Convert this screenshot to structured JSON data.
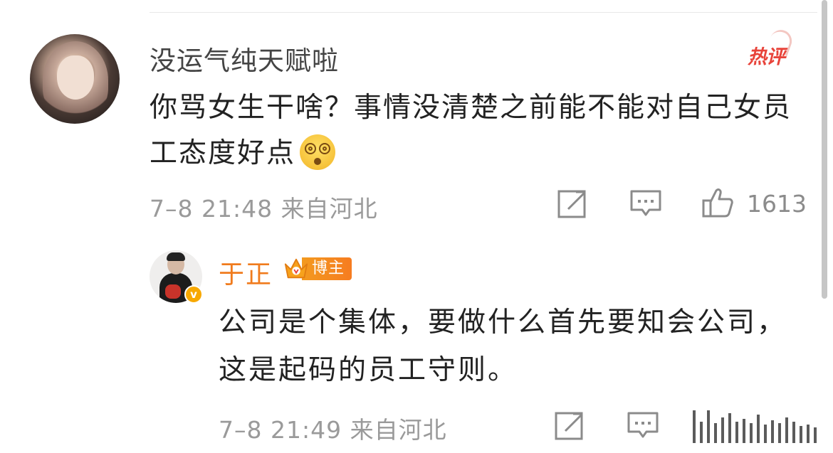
{
  "comment": {
    "username": "没运气纯天赋啦",
    "hot_label": "热评",
    "text": "你骂女生干啥？事情没清楚之前能不能对自己女员工态度好点",
    "meta": "7–8 21:48 来自河北",
    "like_count": "1613"
  },
  "reply": {
    "username": "于正",
    "badge_label": "博主",
    "text": "公司是个集体，要做什么首先要知会公司，这是起码的员工守则。",
    "meta": "7–8 21:49 来自河北"
  },
  "icons": {
    "share": "share-icon",
    "comment": "comment-icon",
    "like": "like-icon",
    "emoji": "dizzy-face-emoji",
    "verified": "verified-v-icon",
    "crown": "crown-icon"
  },
  "colors": {
    "username_reply": "#f07b1d",
    "hot_badge": "#e8433a",
    "meta_gray": "#9a9a9a",
    "badge_orange": "#f39a1f"
  }
}
